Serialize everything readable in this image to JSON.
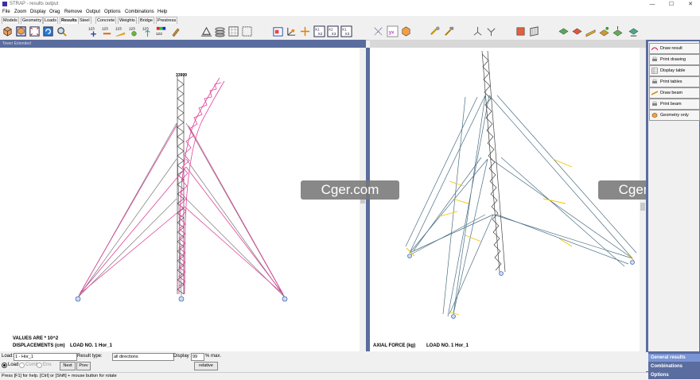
{
  "window": {
    "title": "STRAP - results output",
    "minimize": "—",
    "maximize": "☐",
    "close": "✕"
  },
  "menu": [
    "File",
    "Zoom",
    "Display",
    "Orag",
    "Remove",
    "Output",
    "Options",
    "Combinations",
    "Help"
  ],
  "tabs": [
    "Models",
    "Geometry",
    "Loads",
    "Results",
    "Steel",
    "Concrete",
    "Weights",
    "Bridge",
    "Prestress"
  ],
  "active_tab": "Results",
  "toolbar_icons": [
    "model-3d-icon",
    "cube-icon",
    "fit-icon",
    "refresh-icon",
    "zoom-icon",
    "numbers-plus-icon",
    "numbers-minus-icon",
    "numbers-ruler-icon",
    "numbers-rotate-icon",
    "numbers-axis-icon",
    "numbers-color-icon",
    "paint-icon",
    "support-icon",
    "layers-icon",
    "grid-icon",
    "select-icon",
    "frame-icon",
    "axes-icon",
    "x1x2-icon",
    "x3-icon",
    "x1x3-icon",
    "dots-icon",
    "yx-icon",
    "box-icon",
    "brush-icon",
    "hammer-icon",
    "joint-icon",
    "joint2-icon",
    "cube-red-icon",
    "plane-icon",
    "beam-add-icon",
    "beam-remove-icon",
    "beam-ruler-icon",
    "beam-edit-icon",
    "beam-load-icon",
    "beam-support-icon"
  ],
  "left_view": {
    "header": "Tower Extended",
    "top_label": "33999",
    "values_note": "VALUES ARE * 10^2",
    "result_label": "DISPLACEMENTS (cm)",
    "load_label": "LOAD NO. 1  Hor_1"
  },
  "right_view": {
    "result_label": "AXIAL FORCE   (kg)",
    "load_label": "LOAD NO. 1  Hor_1"
  },
  "watermark": "Cger.com",
  "side_panel": {
    "items": [
      {
        "label": "Draw result",
        "icon": "draw-result-icon"
      },
      {
        "label": "Print drawing",
        "icon": "print-icon"
      },
      {
        "label": "Display table",
        "icon": "table-icon"
      },
      {
        "label": "Print tables",
        "icon": "print-icon"
      },
      {
        "label": "Draw beam",
        "icon": "draw-beam-icon"
      },
      {
        "label": "Print beam",
        "icon": "print-icon"
      },
      {
        "label": "Geometry only",
        "icon": "geometry-icon"
      }
    ],
    "bottom": [
      "General results",
      "Combinations",
      "Options"
    ],
    "axes_icon": "axes-x1x2x3-icon"
  },
  "controls": {
    "load_label": "Load:",
    "load_value": "1 - Hor_1",
    "result_type_label": "Result type:",
    "result_type_value": "all directions",
    "display_label": "Display >",
    "display_value": "99",
    "display_unit": "% max.",
    "radio_load": "Load",
    "radio_comb": "Comb",
    "radio_env": "Env.",
    "next": "Next",
    "prev": "Prev",
    "relative": "relative"
  },
  "status_text": "Press [F1] for help. [Ctrl] or [Shift] + mouse button for rotate",
  "colors": {
    "accent": "#5a6d9e",
    "deformed": "#e0409a",
    "model": "#555555",
    "force": "#f2c200"
  }
}
